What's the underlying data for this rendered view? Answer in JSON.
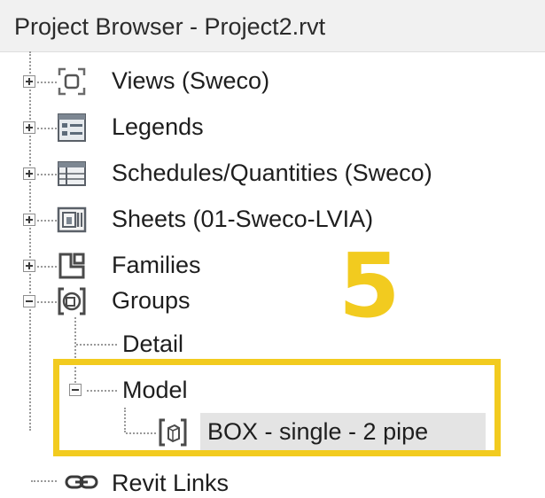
{
  "panel": {
    "title": "Project Browser - Project2.rvt"
  },
  "tree": {
    "items": [
      {
        "label": "Views (Sweco)",
        "icon": "views-icon",
        "state": "collapsed"
      },
      {
        "label": "Legends",
        "icon": "legends-icon",
        "state": "collapsed"
      },
      {
        "label": "Schedules/Quantities (Sweco)",
        "icon": "schedules-icon",
        "state": "collapsed"
      },
      {
        "label": "Sheets (01-Sweco-LVIA)",
        "icon": "sheets-icon",
        "state": "collapsed"
      },
      {
        "label": "Families",
        "icon": "families-icon",
        "state": "collapsed"
      },
      {
        "label": "Groups",
        "icon": "groups-icon",
        "state": "expanded",
        "children": [
          {
            "label": "Detail"
          },
          {
            "label": "Model",
            "state": "expanded",
            "children": [
              {
                "label": "BOX - single - 2 pipe",
                "icon": "group-instance-icon",
                "selected": true
              }
            ]
          }
        ]
      },
      {
        "label": "Revit Links",
        "icon": "revit-links-icon"
      }
    ]
  },
  "annotation": {
    "step_number": "5",
    "color": "#f2cb1f"
  }
}
